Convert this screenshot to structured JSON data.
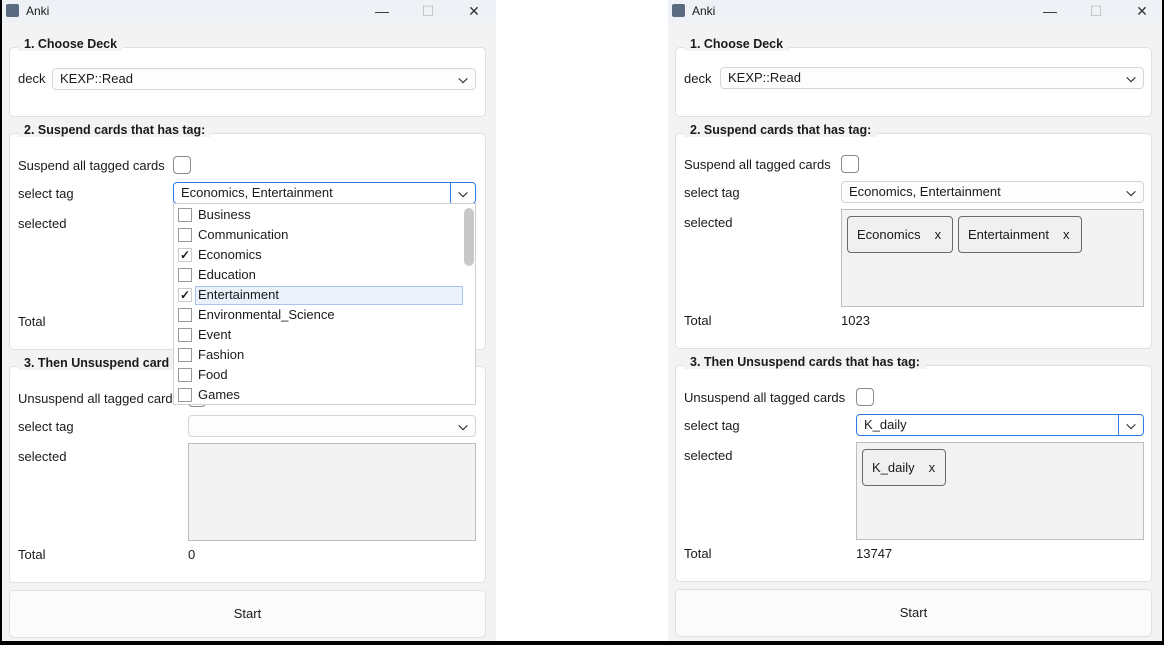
{
  "windows": [
    {
      "title": "Anki",
      "group1": {
        "title": "1. Choose Deck",
        "deck_label": "deck",
        "deck_value": "KEXP::Read"
      },
      "group2": {
        "title": "2. Suspend cards that has tag:",
        "all_label": "Suspend all tagged cards",
        "all_checked": false,
        "select_label": "select tag",
        "select_value": "Economics, Entertainment",
        "selected_label": "selected",
        "total_label": "Total"
      },
      "dropdown": {
        "items": [
          {
            "label": "Business",
            "checked": false
          },
          {
            "label": "Communication",
            "checked": false
          },
          {
            "label": "Economics",
            "checked": true
          },
          {
            "label": "Education",
            "checked": false
          },
          {
            "label": "Entertainment",
            "checked": true,
            "highlighted": true
          },
          {
            "label": "Environmental_Science",
            "checked": false
          },
          {
            "label": "Event",
            "checked": false
          },
          {
            "label": "Fashion",
            "checked": false
          },
          {
            "label": "Food",
            "checked": false
          },
          {
            "label": "Games",
            "checked": false
          }
        ]
      },
      "group3": {
        "title": "3. Then Unsuspend card",
        "all_label": "Unsuspend all tagged card",
        "select_label": "select tag",
        "select_value": "",
        "selected_label": "selected",
        "total_label": "Total",
        "total_value": "0"
      },
      "start_label": "Start"
    },
    {
      "title": "Anki",
      "group1": {
        "title": "1. Choose Deck",
        "deck_label": "deck",
        "deck_value": "KEXP::Read"
      },
      "group2": {
        "title": "2. Suspend cards that has tag:",
        "all_label": "Suspend all tagged cards",
        "all_checked": false,
        "select_label": "select tag",
        "select_value": "Economics, Entertainment",
        "selected_label": "selected",
        "chips": [
          "Economics",
          "Entertainment"
        ],
        "total_label": "Total",
        "total_value": "1023"
      },
      "group3": {
        "title": "3. Then Unsuspend cards that has tag:",
        "all_label": "Unsuspend all tagged cards",
        "all_checked": false,
        "select_label": "select tag",
        "select_value": "K_daily",
        "selected_label": "selected",
        "chips": [
          "K_daily"
        ],
        "total_label": "Total",
        "total_value": "13747"
      },
      "start_label": "Start"
    }
  ],
  "chip_remove": "x",
  "window_controls": {
    "minimize": "—",
    "maximize": "☐",
    "close": "✕"
  },
  "check_mark": "✓",
  "chevron": "⌄",
  "accent_color": "#2f7ce0"
}
